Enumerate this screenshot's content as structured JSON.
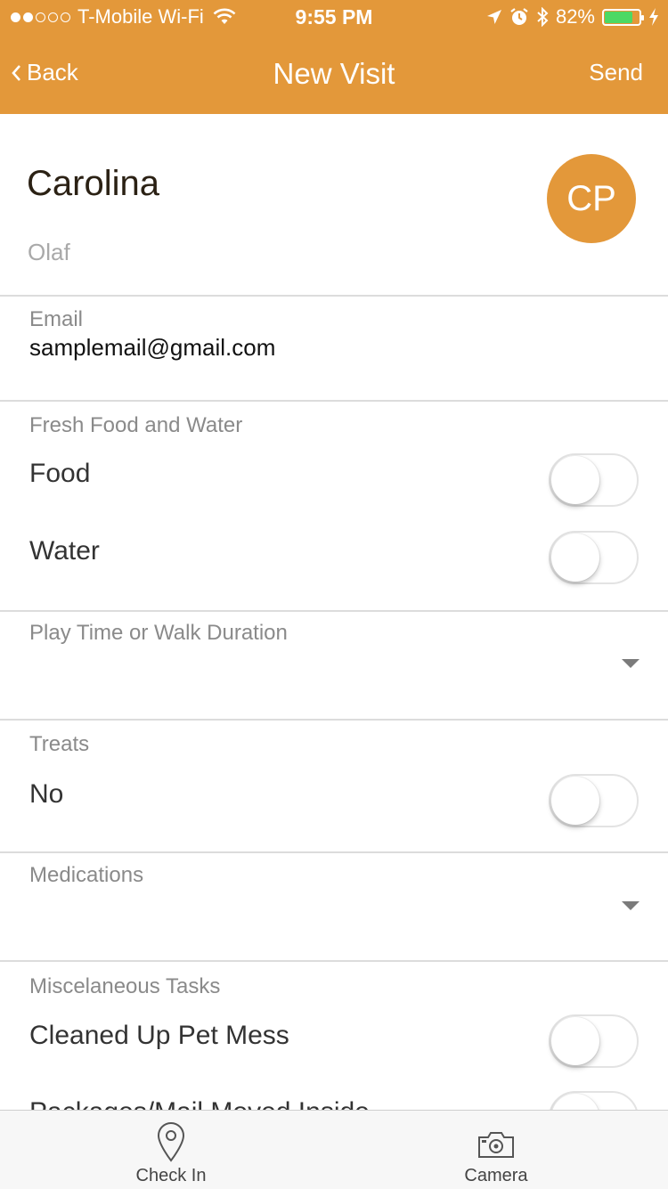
{
  "status_bar": {
    "carrier": "T-Mobile Wi-Fi",
    "time": "9:55 PM",
    "battery_percent": "82%",
    "signal_bars_filled": 2,
    "signal_bars_total": 5,
    "battery_level": 0.82
  },
  "nav": {
    "back_label": "Back",
    "title": "New Visit",
    "send_label": "Send"
  },
  "profile": {
    "name": "Carolina",
    "pet": "Olaf",
    "initials": "CP"
  },
  "email": {
    "label": "Email",
    "value": "samplemail@gmail.com"
  },
  "food_water": {
    "label": "Fresh Food and Water",
    "items": [
      {
        "label": "Food",
        "on": false
      },
      {
        "label": "Water",
        "on": false
      }
    ]
  },
  "play_time": {
    "label": "Play Time or Walk Duration",
    "value": ""
  },
  "treats": {
    "label": "Treats",
    "value": "No",
    "on": false
  },
  "medications": {
    "label": "Medications",
    "value": ""
  },
  "misc": {
    "label": "Miscelaneous Tasks",
    "items": [
      {
        "label": "Cleaned Up Pet Mess",
        "on": false
      },
      {
        "label": "Packages/Mail Moved Inside",
        "on": false
      }
    ]
  },
  "tabbar": {
    "tabs": [
      {
        "label": "Check In",
        "icon": "map-pin-icon"
      },
      {
        "label": "Camera",
        "icon": "camera-icon"
      }
    ]
  },
  "colors": {
    "accent": "#e3983a",
    "battery_fill": "#4cd964"
  }
}
